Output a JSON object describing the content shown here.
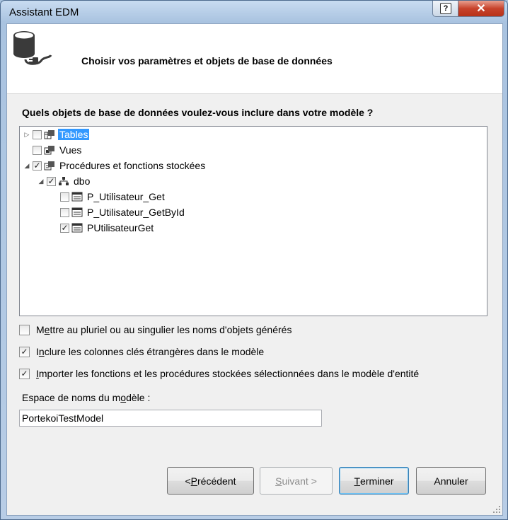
{
  "window": {
    "title": "Assistant EDM",
    "help_glyph": "?",
    "close_glyph": "✕"
  },
  "header": {
    "title": "Choisir vos paramètres et objets de base de données",
    "icon": "database-connection-icon"
  },
  "question": "Quels objets de base de données voulez-vous inclure dans votre modèle ?",
  "tree": {
    "tables": {
      "label": "Tables",
      "checked": false,
      "expanded": false,
      "selected": true
    },
    "views": {
      "label": "Vues",
      "checked": false
    },
    "procs": {
      "label": "Procédures et fonctions stockées",
      "checked": true,
      "expanded": true
    },
    "schema": {
      "label": "dbo",
      "checked": true,
      "expanded": true
    },
    "items": [
      {
        "label": "P_Utilisateur_Get",
        "checked": false
      },
      {
        "label": "P_Utilisateur_GetById",
        "checked": false
      },
      {
        "label": "PUtilisateurGet",
        "checked": true
      }
    ]
  },
  "options": {
    "pluralize": {
      "label_pre": "M",
      "accel": "e",
      "label_post": "ttre au pluriel ou au singulier les noms d'objets générés",
      "checked": false
    },
    "foreign_keys": {
      "label_pre": "I",
      "accel": "n",
      "label_post": "clure les colonnes clés étrangères dans le modèle",
      "checked": true
    },
    "import_procs": {
      "label_pre": "",
      "accel": "I",
      "label_post": "mporter les fonctions et les procédures stockées sélectionnées dans le modèle d'entité",
      "checked": true
    }
  },
  "namespace": {
    "label_pre": "Espace de noms du m",
    "accel": "o",
    "label_post": "dèle :",
    "value": "PortekoiTestModel"
  },
  "buttons": {
    "previous": {
      "pre": "< ",
      "accel": "P",
      "post": "récédent",
      "enabled": true
    },
    "next": {
      "pre": "",
      "accel": "S",
      "post": "uivant >",
      "enabled": false
    },
    "finish": {
      "pre": "",
      "accel": "T",
      "post": "erminer",
      "enabled": true
    },
    "cancel": {
      "label": "Annuler",
      "enabled": true
    }
  },
  "check_glyph": "✓",
  "expanded_glyph": "◢",
  "collapsed_glyph": "▷"
}
